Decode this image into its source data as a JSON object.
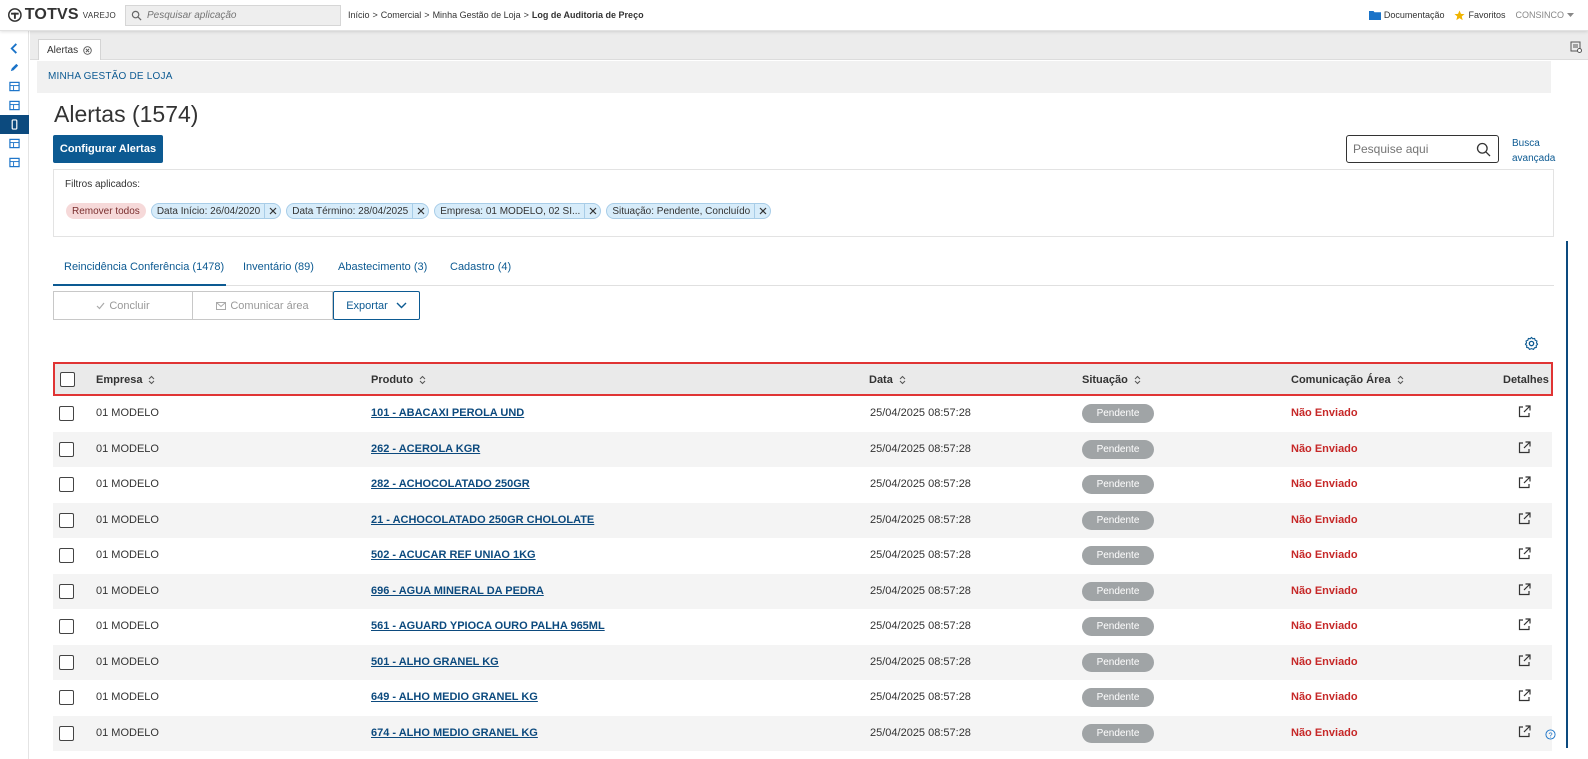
{
  "topbar": {
    "brand": "TOTVS",
    "brand_sub": "VAREJO",
    "search_placeholder": "Pesquisar aplicação",
    "breadcrumb": [
      "Início",
      "Comercial",
      "Minha Gestão de Loja",
      "Log de Auditoria de Preço"
    ],
    "docs_label": "Documentação",
    "favorites_label": "Favoritos",
    "user_label": "CONSINCO"
  },
  "colors": {
    "primary": "#0c5a92",
    "highlight": "#e03434",
    "status_pending": "#a0a4a6",
    "not_sent": "#c62828"
  },
  "open_tab": {
    "label": "Alertas"
  },
  "section": {
    "title": "MINHA GESTÃO DE LOJA"
  },
  "page": {
    "title": "Alertas (1574)",
    "config_button": "Configurar Alertas",
    "search_placeholder": "Pesquise aqui",
    "advanced_search_line1": "Busca",
    "advanced_search_line2": "avançada"
  },
  "filters": {
    "label": "Filtros aplicados:",
    "remove_all": "Remover todos",
    "chips": [
      "Data Início: 26/04/2020",
      "Data Término: 28/04/2025",
      "Empresa: 01 MODELO, 02 SI...",
      "Situação: Pendente, Concluído"
    ]
  },
  "tabs": [
    "Reincidência Conferência (1478)",
    "Inventário (89)",
    "Abastecimento (3)",
    "Cadastro (4)"
  ],
  "actions": {
    "conclude": "Concluir",
    "communicate": "Comunicar área",
    "export": "Exportar"
  },
  "table": {
    "headers": {
      "empresa": "Empresa",
      "produto": "Produto",
      "data": "Data",
      "situacao": "Situação",
      "comunicacao": "Comunicação Área",
      "detalhes": "Detalhes"
    },
    "rows": [
      {
        "empresa": "01 MODELO",
        "produto": "101 - ABACAXI PEROLA UND",
        "data": "25/04/2025 08:57:28",
        "situacao": "Pendente",
        "comunicacao": "Não Enviado"
      },
      {
        "empresa": "01 MODELO",
        "produto": "262 - ACEROLA KGR",
        "data": "25/04/2025 08:57:28",
        "situacao": "Pendente",
        "comunicacao": "Não Enviado"
      },
      {
        "empresa": "01 MODELO",
        "produto": "282 - ACHOCOLATADO 250GR",
        "data": "25/04/2025 08:57:28",
        "situacao": "Pendente",
        "comunicacao": "Não Enviado"
      },
      {
        "empresa": "01 MODELO",
        "produto": "21 - ACHOCOLATADO 250GR CHOLOLATE",
        "data": "25/04/2025 08:57:28",
        "situacao": "Pendente",
        "comunicacao": "Não Enviado"
      },
      {
        "empresa": "01 MODELO",
        "produto": "502 - ACUCAR REF UNIAO 1KG",
        "data": "25/04/2025 08:57:28",
        "situacao": "Pendente",
        "comunicacao": "Não Enviado"
      },
      {
        "empresa": "01 MODELO",
        "produto": "696 - AGUA MINERAL DA PEDRA",
        "data": "25/04/2025 08:57:28",
        "situacao": "Pendente",
        "comunicacao": "Não Enviado"
      },
      {
        "empresa": "01 MODELO",
        "produto": "561 - AGUARD YPIOCA OURO PALHA 965ML",
        "data": "25/04/2025 08:57:28",
        "situacao": "Pendente",
        "comunicacao": "Não Enviado"
      },
      {
        "empresa": "01 MODELO",
        "produto": "501 - ALHO GRANEL KG",
        "data": "25/04/2025 08:57:28",
        "situacao": "Pendente",
        "comunicacao": "Não Enviado"
      },
      {
        "empresa": "01 MODELO",
        "produto": "649 - ALHO MEDIO GRANEL KG",
        "data": "25/04/2025 08:57:28",
        "situacao": "Pendente",
        "comunicacao": "Não Enviado"
      },
      {
        "empresa": "01 MODELO",
        "produto": "674 - ALHO MEDIO GRANEL KG",
        "data": "25/04/2025 08:57:28",
        "situacao": "Pendente",
        "comunicacao": "Não Enviado"
      }
    ]
  }
}
